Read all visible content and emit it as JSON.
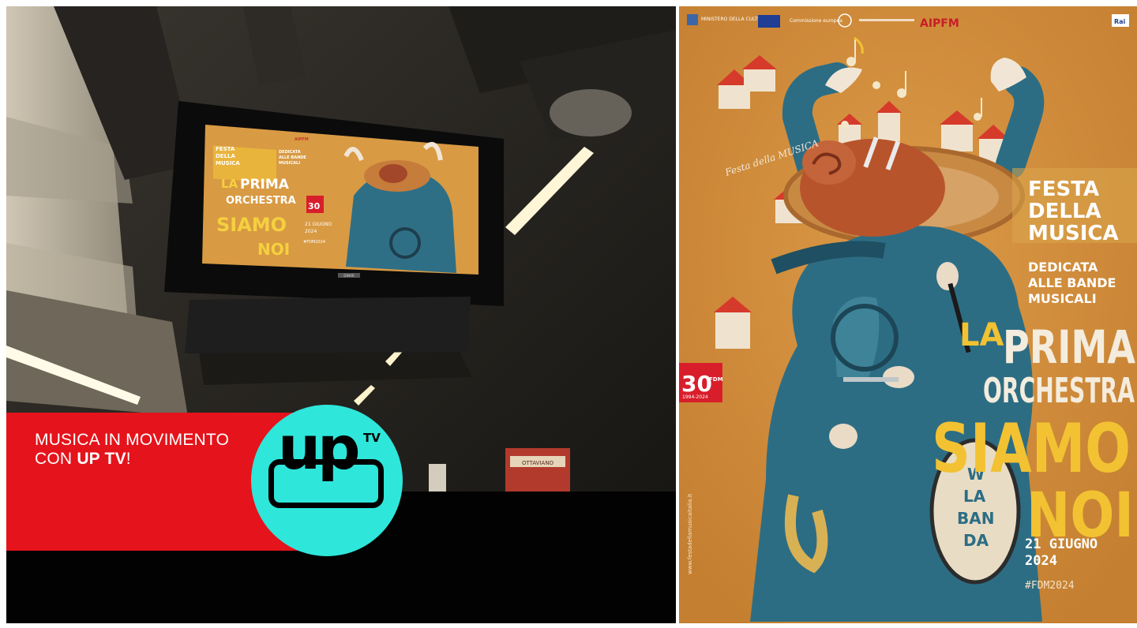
{
  "banner": {
    "line1": "MUSICA IN MOVIMENTO",
    "line2_prefix": "CON ",
    "line2_bold": "UP TV",
    "line2_suffix": "!"
  },
  "logo": {
    "main": "up",
    "superscript": "TV"
  },
  "poster": {
    "festa": [
      "FESTA",
      "DELLA",
      "MUSICA"
    ],
    "dedicata": [
      "DEDICATA",
      "ALLE BANDE",
      "MUSICALI"
    ],
    "la": "LA",
    "prima": "PRIMA",
    "orchestra": "ORCHESTRA",
    "siamo": "SIAMO",
    "noi": "NOI",
    "date": [
      "21 GIUGNO",
      "2024"
    ],
    "hashtag": "#FDM2024",
    "website": "www.festadellamusicaitalia.it",
    "anniversary_number": "30",
    "anniversary_label": "FDM",
    "anniversary_years": "1994-2024",
    "header_logos": [
      "MINISTERO DELLA CULTURA",
      "Commissione europea",
      "AIPFM",
      "Rai"
    ],
    "script_logo": "Festa della MUSICA",
    "drum_text": [
      "W",
      "LA",
      "BAN",
      "DA"
    ]
  },
  "screen_poster": {
    "festa": [
      "FESTA",
      "DELLA",
      "MUSICA"
    ],
    "dedicata": [
      "DEDICATA",
      "ALLE BANDE",
      "MUSICALI"
    ],
    "la": "LA",
    "prima": "PRIMA",
    "orchestra": "ORCHESTRA",
    "siamo": "SIAMO",
    "noi": "NOI",
    "date": [
      "21 GIUGNO",
      "2024"
    ],
    "hashtag": "#FDM2024",
    "aipfm": "AIPFM",
    "brand": "DIMAR"
  },
  "station_sign": "OTTAVIANO",
  "colors": {
    "banner_red": "#e5131b",
    "logo_cyan": "#2ee6da",
    "poster_orange": "#d08c3a",
    "figure_blue": "#2d6d84",
    "accent_yellow": "#f2c232"
  }
}
